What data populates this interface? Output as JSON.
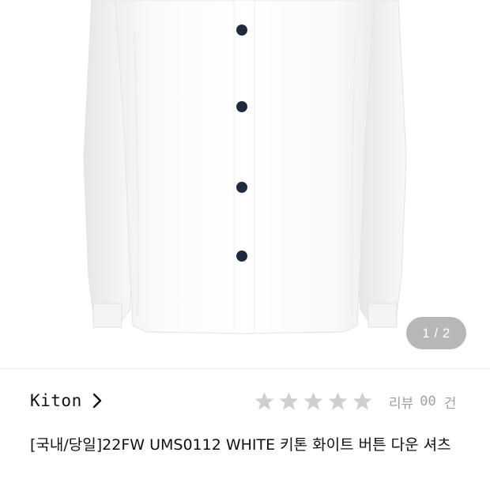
{
  "product_image": {
    "description_icon": "white-shirt-image",
    "counter": "1 / 2"
  },
  "brand": {
    "name": "Kiton",
    "chevron_icon": "chevron-right-icon"
  },
  "rating": {
    "stars_filled": 0,
    "stars_total": 5,
    "star_color": "#cfcfcf",
    "label": "리뷰",
    "count": "00",
    "unit": "건"
  },
  "product": {
    "title": "[국내/당일]22FW UMS0112 WHITE 키톤 화이트 버튼 다운 셔츠"
  }
}
